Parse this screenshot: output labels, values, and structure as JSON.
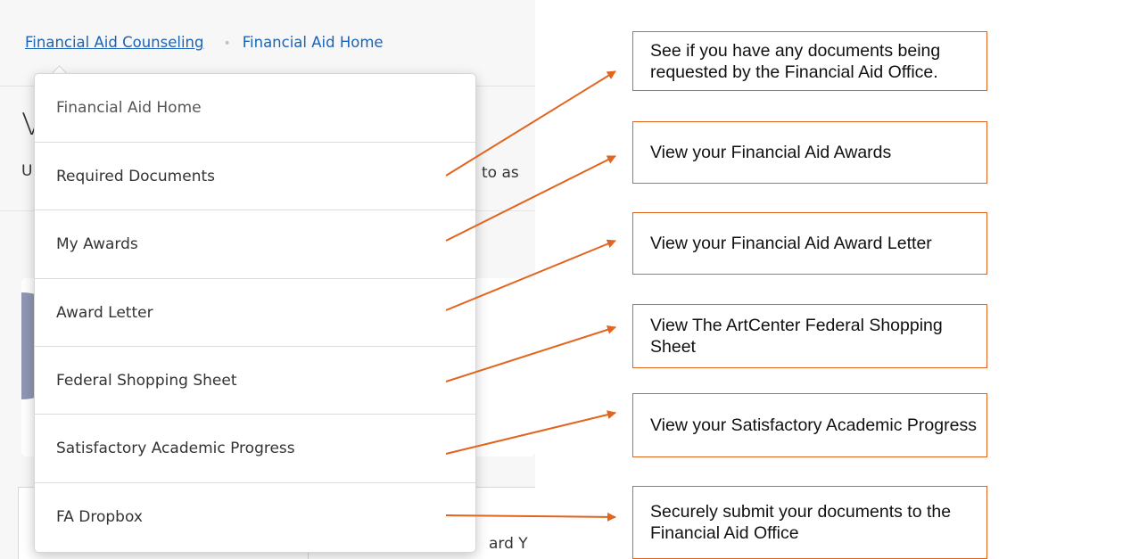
{
  "breadcrumb": {
    "parent": "Financial Aid Counseling",
    "separator": "•",
    "current": "Financial Aid Home"
  },
  "page_fragments": {
    "heading_initial": "V",
    "subtitle_initial": "U",
    "subtitle_tail": "to as",
    "table_header_tail": "ard Y"
  },
  "menu": {
    "items": [
      {
        "label": "Financial Aid Home"
      },
      {
        "label": "Required Documents"
      },
      {
        "label": "My Awards"
      },
      {
        "label": "Award Letter"
      },
      {
        "label": "Federal Shopping Sheet"
      },
      {
        "label": "Satisfactory Academic Progress"
      },
      {
        "label": "FA Dropbox"
      }
    ]
  },
  "callouts": [
    {
      "text": "See if you have any documents being requested by the Financial Aid Office."
    },
    {
      "text": "View your Financial Aid Awards"
    },
    {
      "text": "View your Financial Aid Award Letter"
    },
    {
      "text": "View The ArtCenter Federal Shopping Sheet"
    },
    {
      "text": "View your Satisfactory Academic Progress"
    },
    {
      "text": "Securely submit your documents to the Financial Aid Office"
    }
  ],
  "colors": {
    "link_blue": "#1a64b8",
    "annotation_orange": "#e2651f",
    "avatar": "#8f96b3"
  }
}
